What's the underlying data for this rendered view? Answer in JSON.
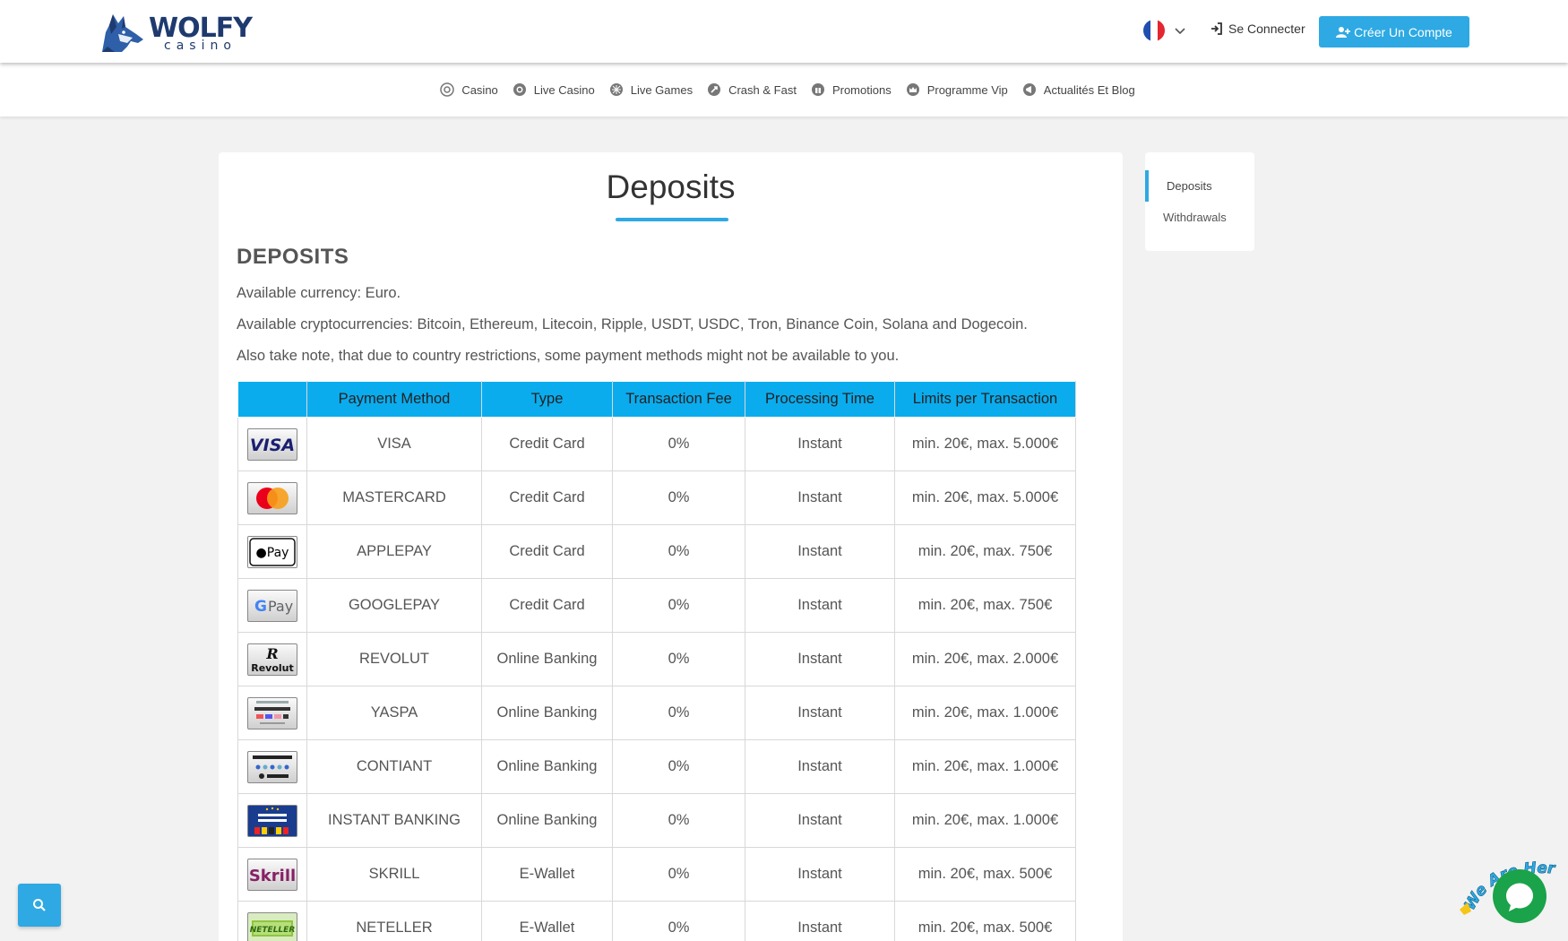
{
  "header": {
    "logo_word": "WOLFY",
    "logo_sub": "casino",
    "login_label": "Se Connecter",
    "register_label": "Créer Un Compte"
  },
  "nav": {
    "items": [
      {
        "label": "Casino",
        "icon": "casino-icon"
      },
      {
        "label": "Live Casino",
        "icon": "live-casino-icon"
      },
      {
        "label": "Live Games",
        "icon": "live-games-icon"
      },
      {
        "label": "Crash & Fast",
        "icon": "rocket-icon"
      },
      {
        "label": "Promotions",
        "icon": "gift-icon"
      },
      {
        "label": "Programme Vip",
        "icon": "crown-icon"
      },
      {
        "label": "Actualités Et Blog",
        "icon": "megaphone-icon"
      }
    ]
  },
  "main": {
    "title": "Deposits",
    "section_heading": "DEPOSITS",
    "paragraphs": [
      "Available currency: Euro.",
      "Available cryptocurrencies: Bitcoin, Ethereum, Litecoin, Ripple, USDT, USDC, Tron, Binance Coin, Solana and Dogecoin.",
      "Also take note, that due to country restrictions, some payment methods might not be available to you."
    ],
    "table": {
      "headers": [
        "",
        "Payment Method",
        "Type",
        "Transaction Fee",
        "Processing Time",
        "Limits per Transaction"
      ],
      "rows": [
        {
          "logo": "visa-logo",
          "method": "VISA",
          "type": "Credit Card",
          "fee": "0%",
          "time": "Instant",
          "limits": "min. 20€, max. 5.000€"
        },
        {
          "logo": "mastercard-logo",
          "method": "MASTERCARD",
          "type": "Credit Card",
          "fee": "0%",
          "time": "Instant",
          "limits": "min. 20€, max. 5.000€"
        },
        {
          "logo": "applepay-logo",
          "method": "APPLEPAY",
          "type": "Credit Card",
          "fee": "0%",
          "time": "Instant",
          "limits": "min. 20€, max. 750€"
        },
        {
          "logo": "googlepay-logo",
          "method": "GOOGLEPAY",
          "type": "Credit Card",
          "fee": "0%",
          "time": "Instant",
          "limits": "min. 20€, max. 750€"
        },
        {
          "logo": "revolut-logo",
          "method": "REVOLUT",
          "type": "Online Banking",
          "fee": "0%",
          "time": "Instant",
          "limits": "min. 20€, max. 2.000€"
        },
        {
          "logo": "yaspa-logo",
          "method": "YASPA",
          "type": "Online Banking",
          "fee": "0%",
          "time": "Instant",
          "limits": "min. 20€, max. 1.000€"
        },
        {
          "logo": "contiant-logo",
          "method": "CONTIANT",
          "type": "Online Banking",
          "fee": "0%",
          "time": "Instant",
          "limits": "min. 20€, max. 1.000€"
        },
        {
          "logo": "instant-banking-logo",
          "method": "INSTANT BANKING",
          "type": "Online Banking",
          "fee": "0%",
          "time": "Instant",
          "limits": "min. 20€, max. 1.000€"
        },
        {
          "logo": "skrill-logo",
          "method": "SKRILL",
          "type": "E-Wallet",
          "fee": "0%",
          "time": "Instant",
          "limits": "min. 20€, max. 500€"
        },
        {
          "logo": "neteller-logo",
          "method": "NETELLER",
          "type": "E-Wallet",
          "fee": "0%",
          "time": "Instant",
          "limits": "min. 20€, max. 500€"
        }
      ]
    }
  },
  "sidebar": {
    "items": [
      {
        "label": "Deposits",
        "active": true
      },
      {
        "label": "Withdrawals",
        "active": false
      }
    ]
  },
  "chat": {
    "badge_text": "We Are Here!"
  },
  "colors": {
    "accent": "#2ea9e3",
    "table_header": "#0aacee",
    "brand_navy": "#1e3a6e"
  }
}
